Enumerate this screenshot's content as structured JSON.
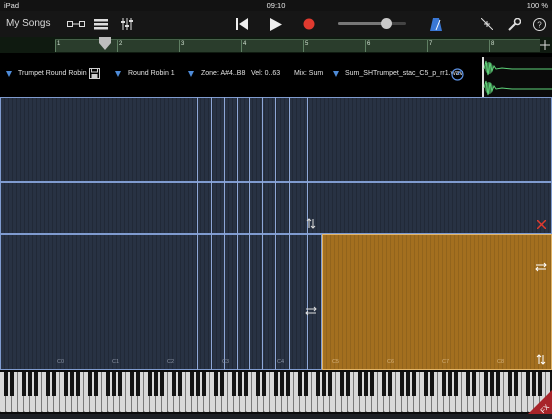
{
  "status": {
    "device": "iPad",
    "time": "09:10",
    "battery": "100 %"
  },
  "toolbar": {
    "back_label": "My Songs",
    "icons": [
      "view-toggle-icon",
      "tracks-icon",
      "mixer-icon",
      "rewind-icon",
      "play-icon",
      "record-icon",
      "volume-slider",
      "metronome-icon",
      "collapse-icon",
      "settings-wrench-icon",
      "help-icon"
    ],
    "volume_level": 0.72
  },
  "ruler": {
    "bars": [
      "1",
      "2",
      "3",
      "4",
      "5",
      "6",
      "7",
      "8"
    ],
    "playhead_bar": 1.8
  },
  "info": {
    "instrument": "Trumpet Round Robin",
    "group": "Round Robin 1",
    "zone": "Zone: A#4..B8",
    "velocity": "Vel: 0..63",
    "mix": "Mix: Sum",
    "file": "Sum_SHTrumpet_stac_C5_p_rr1.wav"
  },
  "grid": {
    "key_labels": [
      "C0",
      "C1",
      "C2",
      "C3",
      "C4",
      "C5",
      "C6",
      "C7",
      "C8"
    ]
  },
  "colors": {
    "zone_border": "#7f9bcf",
    "selected_zone": "#a36f1f",
    "record": "#e03a2f",
    "accent": "#4e8bd8"
  }
}
